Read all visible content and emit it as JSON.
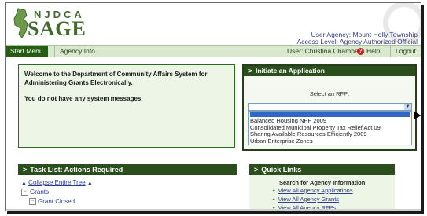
{
  "logo": {
    "org": "NJDCA",
    "name": "SAGE"
  },
  "header": {
    "user_agency": "User Agency: Mount Holly Township",
    "access_level": "Access Level: Agency Authorized Official"
  },
  "nav": {
    "start_menu": "Start Menu",
    "agency_info": "Agency Info",
    "user": "User: Christina Chambers",
    "help": "Help",
    "logout": "Logout"
  },
  "welcome": {
    "title": "Welcome to the Department of Community Affairs System for Administering Grants Electronically.",
    "message": "You do not have any system messages."
  },
  "initiate": {
    "title": "Initiate an Application",
    "select_label": "Select an RFP:",
    "selected_value": "",
    "options": [
      "Balanced Housing NPP 2009",
      "Consolidated Municipal Property Tax Relief Act 09",
      "Sharing Available Resources Efficiently 2009",
      "Urban Enterprise Zones"
    ]
  },
  "task_list": {
    "title": "Task List: Actions Required",
    "collapse": "Collapse Entire Tree",
    "grants": "Grants",
    "grant_closed": "Grant Closed"
  },
  "quick_links": {
    "title": "Quick Links",
    "search_label": "Search for Agency Information",
    "links": [
      "View All Agency Applications",
      "View All Agency Grants",
      "View All Agency RFPs"
    ]
  },
  "colors": {
    "brand_green": "#2a4f1c",
    "nav_bg": "#d9e8cf",
    "link_blue": "#2b3d9a",
    "help_red": "#c02020"
  }
}
